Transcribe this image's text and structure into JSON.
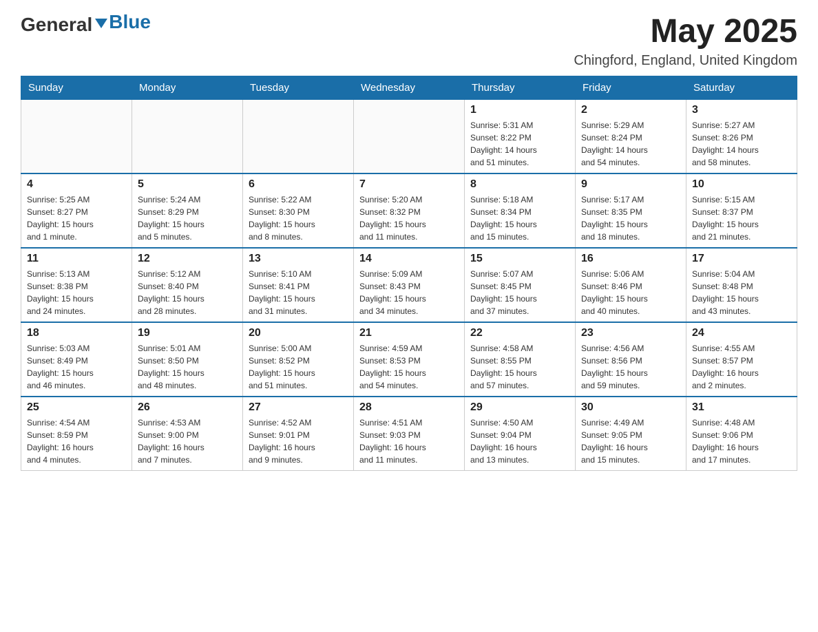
{
  "header": {
    "logo": {
      "general": "General",
      "arrow": "▲",
      "blue": "Blue"
    },
    "title": "May 2025",
    "location": "Chingford, England, United Kingdom"
  },
  "calendar": {
    "days_of_week": [
      "Sunday",
      "Monday",
      "Tuesday",
      "Wednesday",
      "Thursday",
      "Friday",
      "Saturday"
    ],
    "weeks": [
      {
        "cells": [
          {
            "day": "",
            "info": ""
          },
          {
            "day": "",
            "info": ""
          },
          {
            "day": "",
            "info": ""
          },
          {
            "day": "",
            "info": ""
          },
          {
            "day": "1",
            "info": "Sunrise: 5:31 AM\nSunset: 8:22 PM\nDaylight: 14 hours\nand 51 minutes."
          },
          {
            "day": "2",
            "info": "Sunrise: 5:29 AM\nSunset: 8:24 PM\nDaylight: 14 hours\nand 54 minutes."
          },
          {
            "day": "3",
            "info": "Sunrise: 5:27 AM\nSunset: 8:26 PM\nDaylight: 14 hours\nand 58 minutes."
          }
        ]
      },
      {
        "cells": [
          {
            "day": "4",
            "info": "Sunrise: 5:25 AM\nSunset: 8:27 PM\nDaylight: 15 hours\nand 1 minute."
          },
          {
            "day": "5",
            "info": "Sunrise: 5:24 AM\nSunset: 8:29 PM\nDaylight: 15 hours\nand 5 minutes."
          },
          {
            "day": "6",
            "info": "Sunrise: 5:22 AM\nSunset: 8:30 PM\nDaylight: 15 hours\nand 8 minutes."
          },
          {
            "day": "7",
            "info": "Sunrise: 5:20 AM\nSunset: 8:32 PM\nDaylight: 15 hours\nand 11 minutes."
          },
          {
            "day": "8",
            "info": "Sunrise: 5:18 AM\nSunset: 8:34 PM\nDaylight: 15 hours\nand 15 minutes."
          },
          {
            "day": "9",
            "info": "Sunrise: 5:17 AM\nSunset: 8:35 PM\nDaylight: 15 hours\nand 18 minutes."
          },
          {
            "day": "10",
            "info": "Sunrise: 5:15 AM\nSunset: 8:37 PM\nDaylight: 15 hours\nand 21 minutes."
          }
        ]
      },
      {
        "cells": [
          {
            "day": "11",
            "info": "Sunrise: 5:13 AM\nSunset: 8:38 PM\nDaylight: 15 hours\nand 24 minutes."
          },
          {
            "day": "12",
            "info": "Sunrise: 5:12 AM\nSunset: 8:40 PM\nDaylight: 15 hours\nand 28 minutes."
          },
          {
            "day": "13",
            "info": "Sunrise: 5:10 AM\nSunset: 8:41 PM\nDaylight: 15 hours\nand 31 minutes."
          },
          {
            "day": "14",
            "info": "Sunrise: 5:09 AM\nSunset: 8:43 PM\nDaylight: 15 hours\nand 34 minutes."
          },
          {
            "day": "15",
            "info": "Sunrise: 5:07 AM\nSunset: 8:45 PM\nDaylight: 15 hours\nand 37 minutes."
          },
          {
            "day": "16",
            "info": "Sunrise: 5:06 AM\nSunset: 8:46 PM\nDaylight: 15 hours\nand 40 minutes."
          },
          {
            "day": "17",
            "info": "Sunrise: 5:04 AM\nSunset: 8:48 PM\nDaylight: 15 hours\nand 43 minutes."
          }
        ]
      },
      {
        "cells": [
          {
            "day": "18",
            "info": "Sunrise: 5:03 AM\nSunset: 8:49 PM\nDaylight: 15 hours\nand 46 minutes."
          },
          {
            "day": "19",
            "info": "Sunrise: 5:01 AM\nSunset: 8:50 PM\nDaylight: 15 hours\nand 48 minutes."
          },
          {
            "day": "20",
            "info": "Sunrise: 5:00 AM\nSunset: 8:52 PM\nDaylight: 15 hours\nand 51 minutes."
          },
          {
            "day": "21",
            "info": "Sunrise: 4:59 AM\nSunset: 8:53 PM\nDaylight: 15 hours\nand 54 minutes."
          },
          {
            "day": "22",
            "info": "Sunrise: 4:58 AM\nSunset: 8:55 PM\nDaylight: 15 hours\nand 57 minutes."
          },
          {
            "day": "23",
            "info": "Sunrise: 4:56 AM\nSunset: 8:56 PM\nDaylight: 15 hours\nand 59 minutes."
          },
          {
            "day": "24",
            "info": "Sunrise: 4:55 AM\nSunset: 8:57 PM\nDaylight: 16 hours\nand 2 minutes."
          }
        ]
      },
      {
        "cells": [
          {
            "day": "25",
            "info": "Sunrise: 4:54 AM\nSunset: 8:59 PM\nDaylight: 16 hours\nand 4 minutes."
          },
          {
            "day": "26",
            "info": "Sunrise: 4:53 AM\nSunset: 9:00 PM\nDaylight: 16 hours\nand 7 minutes."
          },
          {
            "day": "27",
            "info": "Sunrise: 4:52 AM\nSunset: 9:01 PM\nDaylight: 16 hours\nand 9 minutes."
          },
          {
            "day": "28",
            "info": "Sunrise: 4:51 AM\nSunset: 9:03 PM\nDaylight: 16 hours\nand 11 minutes."
          },
          {
            "day": "29",
            "info": "Sunrise: 4:50 AM\nSunset: 9:04 PM\nDaylight: 16 hours\nand 13 minutes."
          },
          {
            "day": "30",
            "info": "Sunrise: 4:49 AM\nSunset: 9:05 PM\nDaylight: 16 hours\nand 15 minutes."
          },
          {
            "day": "31",
            "info": "Sunrise: 4:48 AM\nSunset: 9:06 PM\nDaylight: 16 hours\nand 17 minutes."
          }
        ]
      }
    ]
  }
}
